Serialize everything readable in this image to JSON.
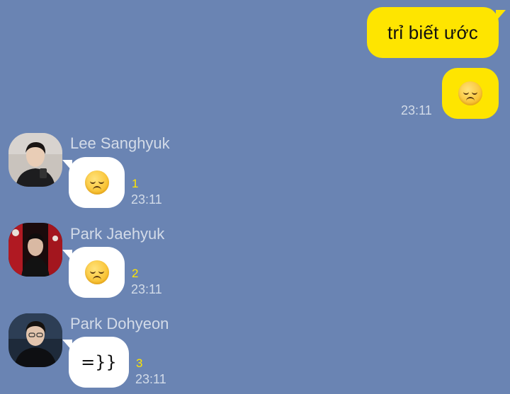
{
  "outgoing": [
    {
      "text": "trỉ biết ước"
    },
    {
      "emoji": "sad-face",
      "time": "23:11"
    }
  ],
  "incoming": [
    {
      "sender": "Lee Sanghyuk",
      "emoji": "sad-face",
      "unread": "1",
      "time": "23:11"
    },
    {
      "sender": "Park Jaehyuk",
      "emoji": "sad-face",
      "unread": "2",
      "time": "23:11"
    },
    {
      "sender": "Park Dohyeon",
      "text": "=}}",
      "unread": "3",
      "time": "23:11"
    }
  ],
  "colors": {
    "background": "#6a84b3",
    "outgoing_bubble": "#fee500",
    "incoming_bubble": "#ffffff",
    "unread_count": "#fee500",
    "meta_text": "#d2dbe8"
  }
}
